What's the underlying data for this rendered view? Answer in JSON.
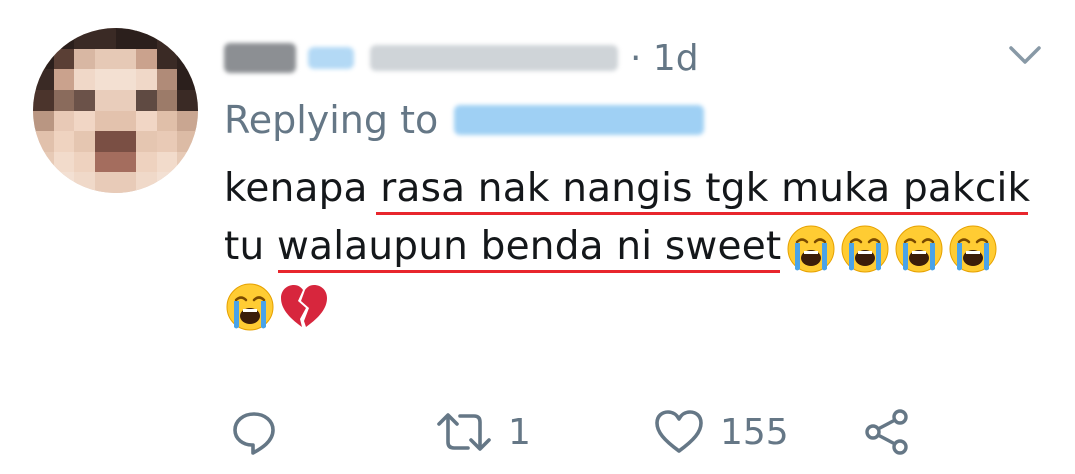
{
  "tweet": {
    "time": "· 1d",
    "replying_to_label": "Replying to",
    "text_line1": "kenapa rasa nak nangis tgk muka pakcik",
    "text_line2": "tu walaupun benda ni sweet",
    "emojis_line2": [
      "loudly-crying-face",
      "loudly-crying-face",
      "loudly-crying-face",
      "loudly-crying-face"
    ],
    "emojis_line3": [
      "loudly-crying-face",
      "broken-heart"
    ]
  },
  "actions": {
    "reply_icon": "reply-icon",
    "retweet_icon": "retweet-icon",
    "retweet_count": "1",
    "like_icon": "heart-icon",
    "like_count": "155",
    "share_icon": "share-icon"
  },
  "colors": {
    "text": "#14171a",
    "secondary": "#657786",
    "underline": "#e8262d",
    "link": "#1da1f2"
  }
}
